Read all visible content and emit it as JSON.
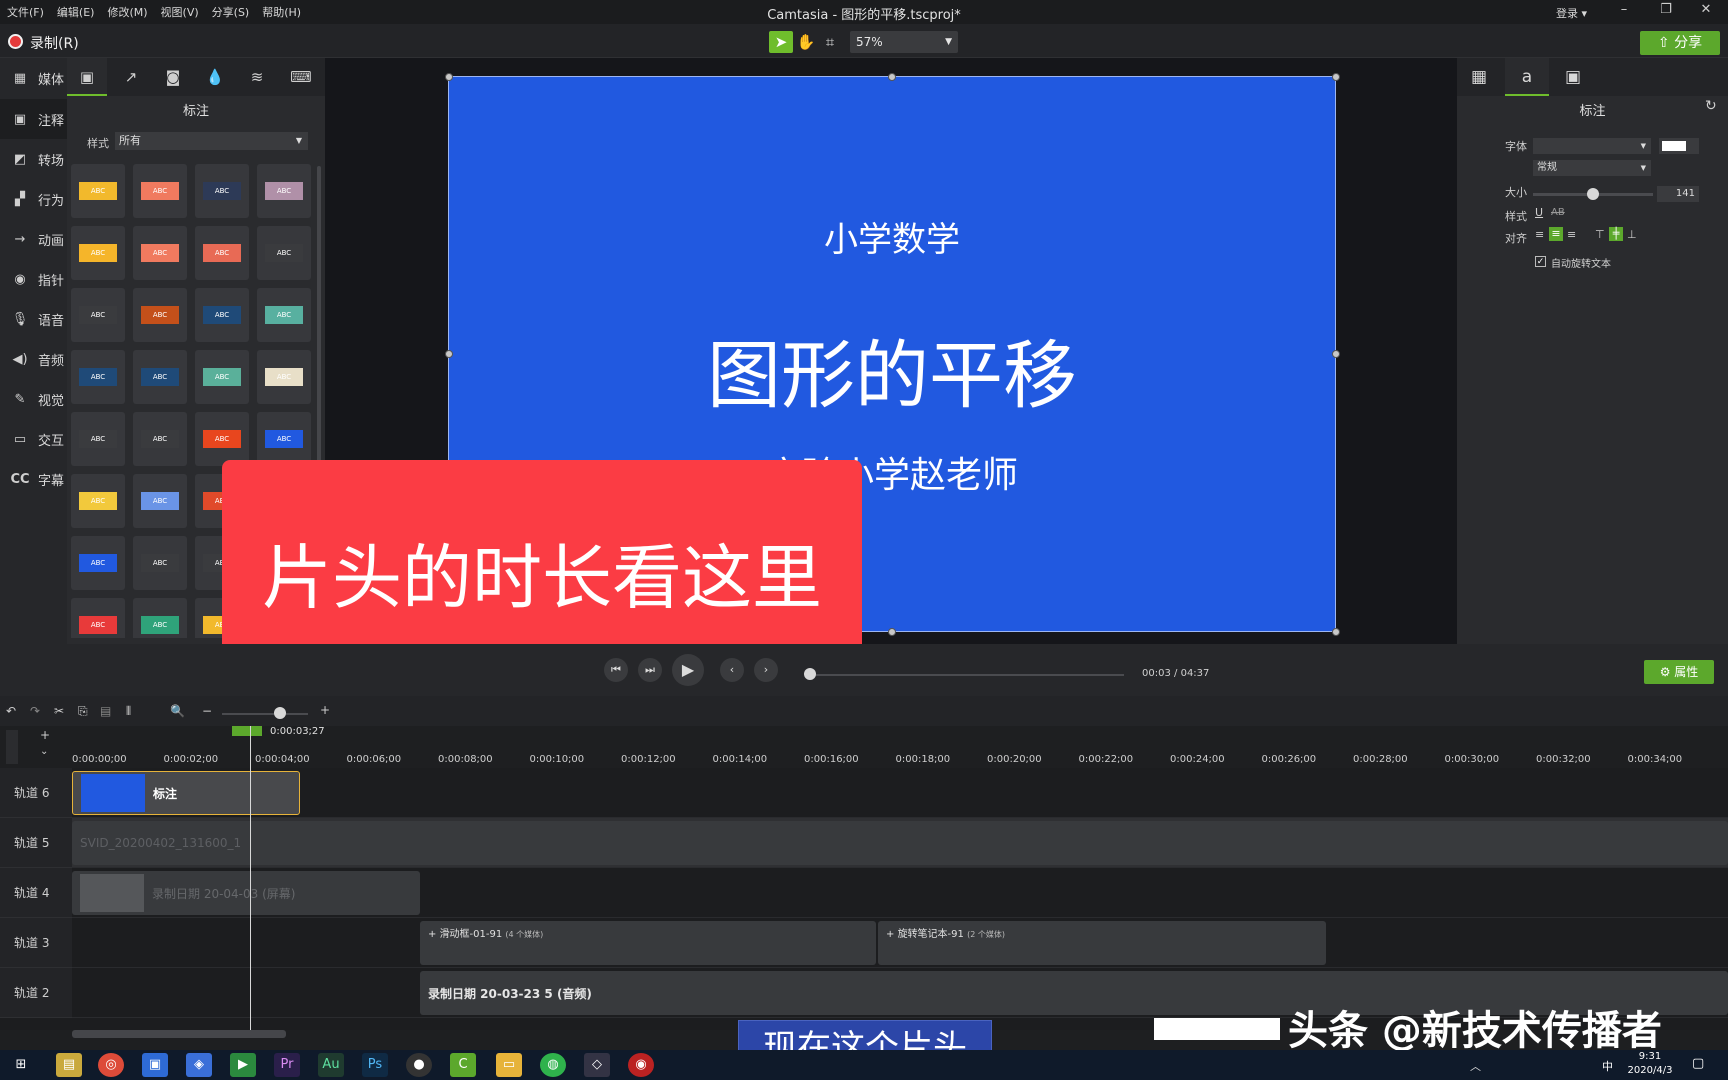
{
  "menu": [
    "文件(F)",
    "编辑(E)",
    "修改(M)",
    "视图(V)",
    "分享(S)",
    "帮助(H)"
  ],
  "app_title": "Camtasia - 图形的平移.tscproj*",
  "login": "登录 ▾",
  "window_controls": [
    "–",
    "❐",
    "✕"
  ],
  "toolbar": {
    "record_label": "录制(R)",
    "zoom": "57%",
    "share_label": "分享"
  },
  "left_nav": [
    {
      "label": "媒体",
      "icon": "media-icon"
    },
    {
      "label": "注释",
      "icon": "annotation-icon"
    },
    {
      "label": "转场",
      "icon": "transition-icon"
    },
    {
      "label": "行为",
      "icon": "behavior-icon"
    },
    {
      "label": "动画",
      "icon": "animation-icon"
    },
    {
      "label": "指针",
      "icon": "cursor-icon"
    },
    {
      "label": "语音",
      "icon": "microphone-icon"
    },
    {
      "label": "音频",
      "icon": "audio-icon"
    },
    {
      "label": "视觉",
      "icon": "visual-effects-icon"
    },
    {
      "label": "交互",
      "icon": "interactive-icon"
    },
    {
      "label": "字幕",
      "icon": "captions-icon"
    }
  ],
  "library": {
    "title": "标注",
    "style_label": "样式",
    "style_value": "所有",
    "thumb_label": "ABC"
  },
  "slide": {
    "subtitle_top": "小学数学",
    "title": "图形的平移",
    "subtitle_bottom": "实验小学赵老师"
  },
  "callout_text": "片头的时长看这里",
  "properties": {
    "title": "标注",
    "font_label": "字体",
    "font_style_value": "常规",
    "size_label": "大小",
    "size_value": "141",
    "style_label": "样式",
    "align_label": "对齐",
    "auto_rotate_label": "自动旋转文本"
  },
  "playback": {
    "current": "00:03",
    "separator": "/",
    "total": "04:37",
    "properties_label": "属性"
  },
  "timeline": {
    "playhead_time": "0:00:03;27",
    "ticks": [
      "0:00:00;00",
      "0:00:02;00",
      "0:00:04;00",
      "0:00:06;00",
      "0:00:08;00",
      "0:00:10;00",
      "0:00:12;00",
      "0:00:14;00",
      "0:00:16;00",
      "0:00:18;00",
      "0:00:20;00",
      "0:00:22;00",
      "0:00:24;00",
      "0:00:26;00",
      "0:00:28;00",
      "0:00:30;00",
      "0:00:32;00",
      "0:00:34;00"
    ],
    "tracks": [
      "轨道 6",
      "轨道 5",
      "轨道 4",
      "轨道 3",
      "轨道 2"
    ],
    "clips": {
      "annotation": "标注",
      "track5": "SVID_20200402_131600_1",
      "track4": "录制日期 20-04-03 (屏幕)",
      "track3a": "滑动框-01-91",
      "track3a_count": "(4 个媒体)",
      "track3b": "旋转笔记本-91",
      "track3b_count": "(2 个媒体)",
      "track2": "录制日期 20-03-23 5 (音频)"
    }
  },
  "overlay": {
    "subtitle": "现在这个片头",
    "watermark": "头条 @新技术传播者"
  },
  "taskbar": {
    "time": "9:31",
    "date": "2020/4/3",
    "ime": "中"
  },
  "colors": {
    "accent": "#6fbd2c",
    "slide_bg": "#2159e0",
    "callout": "#fb3c44",
    "record": "#e43a3a"
  }
}
